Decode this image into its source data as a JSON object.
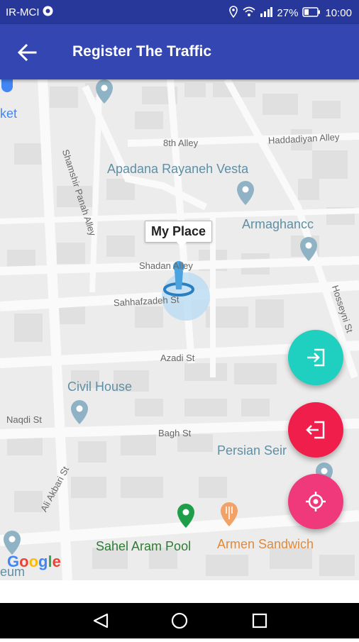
{
  "status_bar": {
    "carrier": "IR-MCI",
    "battery": "27%",
    "time": "10:00"
  },
  "app_bar": {
    "title": "Register The Traffic",
    "back_icon": "arrow-left-icon"
  },
  "map": {
    "pois": {
      "ket": "ket",
      "apadana": "Apadana Rayaneh Vesta",
      "armaghanc": "Armaghancc",
      "civil_house": "Civil House",
      "persian_seir": "Persian Seir",
      "sahel_aram_pool": "Sahel Aram Pool",
      "armen_sandwich": "Armen Sandwich",
      "eum": "eum"
    },
    "streets": {
      "s8th": "8th Alley",
      "haddadiyan": "Haddadiyan Alley",
      "shamshir": "Shamshir Panah Alley",
      "shadan": "Shadan Alley",
      "sahhafzadeh": "Sahhafzadeh St",
      "hosseyni": "Hosseyni St",
      "azadi": "Azadi St",
      "naqdi": "Naqdi St",
      "bagh": "Bagh St",
      "ali_akbari": "Ali Akbari St"
    },
    "my_place_label": "My Place",
    "google_logo": "Google",
    "colors": {
      "google_blue": "#4285f4",
      "google_red": "#ea4335",
      "google_yellow": "#fbbc05",
      "google_green": "#34a853",
      "poi_text": "#5f8fa4",
      "pool_text": "#2e7d32",
      "food_text": "#e08a3c"
    }
  },
  "fabs": {
    "enter": {
      "icon": "login-icon",
      "color": "#1fcfbf"
    },
    "exit": {
      "icon": "logout-icon",
      "color": "#f01e4a"
    },
    "locate": {
      "icon": "crosshair-icon",
      "color": "#f0397a"
    }
  },
  "nav_bar": {
    "back": "triangle-back-icon",
    "home": "circle-home-icon",
    "recents": "square-recents-icon"
  }
}
